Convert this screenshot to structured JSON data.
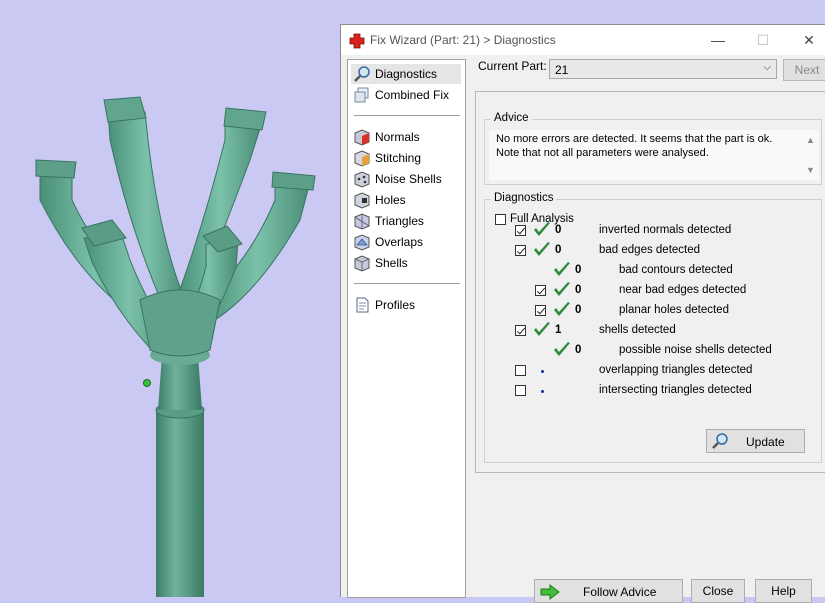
{
  "window": {
    "title": "Fix Wizard (Part: 21) > Diagnostics",
    "controls": {
      "minimize": "—",
      "maximize": "☐",
      "close": "✕"
    }
  },
  "nav": {
    "items": [
      {
        "label": "Diagnostics",
        "icon": "magnifier-icon"
      },
      {
        "label": "Combined Fix",
        "icon": "combined-fix-icon"
      },
      {
        "label": "Normals",
        "icon": "normals-cube-icon"
      },
      {
        "label": "Stitching",
        "icon": "stitching-cube-icon"
      },
      {
        "label": "Noise Shells",
        "icon": "noise-shells-icon"
      },
      {
        "label": "Holes",
        "icon": "holes-cube-icon"
      },
      {
        "label": "Triangles",
        "icon": "triangles-icon"
      },
      {
        "label": "Overlaps",
        "icon": "overlaps-icon"
      },
      {
        "label": "Shells",
        "icon": "shells-icon"
      },
      {
        "label": "Profiles",
        "icon": "profiles-doc-icon"
      }
    ]
  },
  "current_part": {
    "label": "Current Part:",
    "value": "21"
  },
  "next_button": "Next",
  "advice": {
    "title": "Advice",
    "text_line1": "No more errors are detected. It seems that the part is ok.",
    "text_line2": "Note that not all parameters were analysed."
  },
  "diagnostics": {
    "title": "Diagnostics",
    "full_analysis_label": "Full Analysis",
    "full_analysis_checked": false,
    "rows": [
      {
        "checkbox": true,
        "checked": true,
        "status": "ok",
        "count": "0",
        "label": "inverted normals detected",
        "indent": 0
      },
      {
        "checkbox": true,
        "checked": true,
        "status": "ok",
        "count": "0",
        "label": "bad edges detected",
        "indent": 0
      },
      {
        "checkbox": false,
        "checked": false,
        "status": "ok",
        "count": "0",
        "label": "bad contours detected",
        "indent": 1
      },
      {
        "checkbox": true,
        "checked": true,
        "status": "ok",
        "count": "0",
        "label": "near bad edges detected",
        "indent": 1
      },
      {
        "checkbox": true,
        "checked": true,
        "status": "ok",
        "count": "0",
        "label": "planar holes detected",
        "indent": 1
      },
      {
        "checkbox": true,
        "checked": true,
        "status": "ok",
        "count": "1",
        "label": "shells detected",
        "indent": 0
      },
      {
        "checkbox": false,
        "checked": false,
        "status": "ok",
        "count": "0",
        "label": "possible noise shells detected",
        "indent": 1
      },
      {
        "checkbox": true,
        "checked": false,
        "status": "pending",
        "count": "",
        "label": "overlapping triangles detected",
        "indent": 0
      },
      {
        "checkbox": true,
        "checked": false,
        "status": "pending",
        "count": "",
        "label": "intersecting triangles detected",
        "indent": 0
      }
    ],
    "update_button": "Update"
  },
  "footer": {
    "follow_advice": "Follow Advice",
    "close": "Close",
    "help": "Help"
  },
  "colors": {
    "viewport_bg": "#c9c9f3",
    "model": "#5fa38d",
    "check_green": "#2e8b3e",
    "title_icon_red": "#d9221c"
  }
}
